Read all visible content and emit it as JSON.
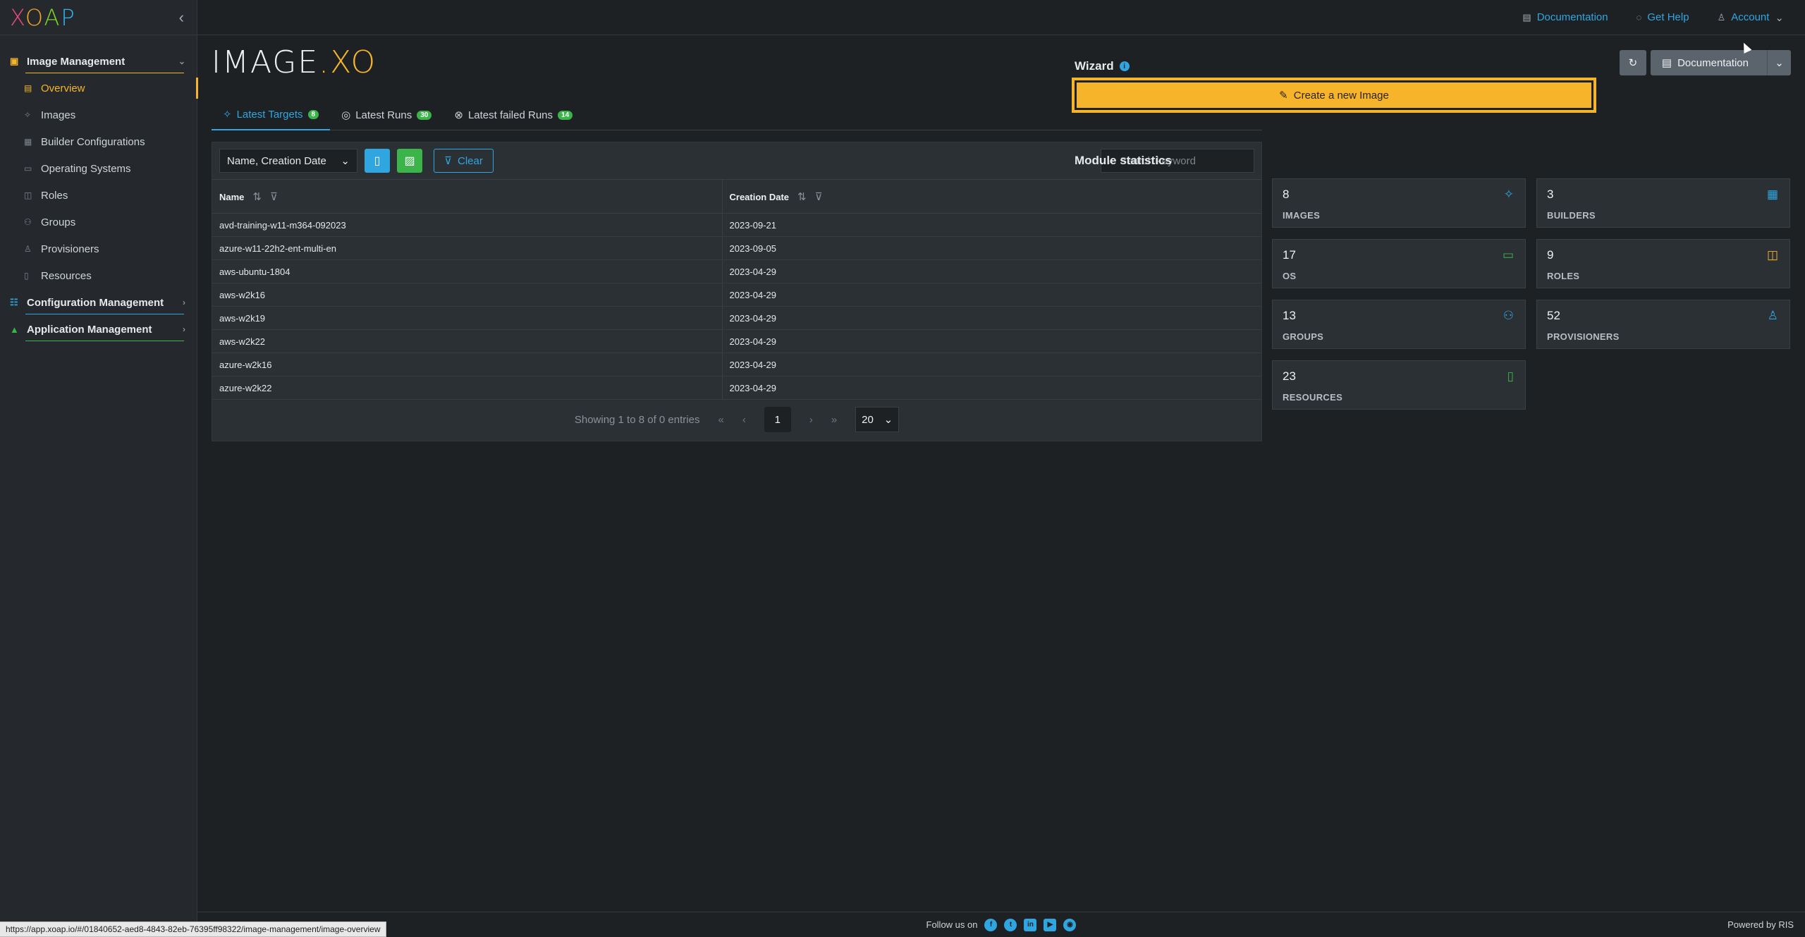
{
  "sidebar": {
    "logo": [
      "X",
      "O",
      "A",
      "P"
    ],
    "collapse_icon": "chevron-left-icon",
    "groups": [
      {
        "label": "Image Management",
        "color": "#f5b42a"
      },
      {
        "label": "Configuration Management",
        "color": "#2fa6e0"
      },
      {
        "label": "Application Management",
        "color": "#3bb44a"
      }
    ],
    "items": [
      {
        "label": "Overview"
      },
      {
        "label": "Images"
      },
      {
        "label": "Builder Configurations"
      },
      {
        "label": "Operating Systems"
      },
      {
        "label": "Roles"
      },
      {
        "label": "Groups"
      },
      {
        "label": "Provisioners"
      },
      {
        "label": "Resources"
      }
    ]
  },
  "topbar": {
    "documentation": "Documentation",
    "get_help": "Get Help",
    "account": "Account"
  },
  "brand": {
    "part1": "IMAGE",
    "dot": ".",
    "part2": "XO"
  },
  "actions": {
    "documentation": "Documentation"
  },
  "tabs": [
    {
      "label": "Latest Targets",
      "count": "8"
    },
    {
      "label": "Latest Runs",
      "count": "30"
    },
    {
      "label": "Latest failed Runs",
      "count": "14"
    }
  ],
  "toolbar": {
    "select_value": "Name, Creation Date",
    "clear_label": "Clear",
    "search_placeholder": "Search keyword"
  },
  "table": {
    "headers": [
      "Name",
      "Creation Date"
    ],
    "rows": [
      [
        "avd-training-w11-m364-092023",
        "2023-09-21"
      ],
      [
        "azure-w11-22h2-ent-multi-en",
        "2023-09-05"
      ],
      [
        "aws-ubuntu-1804",
        "2023-04-29"
      ],
      [
        "aws-w2k16",
        "2023-04-29"
      ],
      [
        "aws-w2k19",
        "2023-04-29"
      ],
      [
        "aws-w2k22",
        "2023-04-29"
      ],
      [
        "azure-w2k16",
        "2023-04-29"
      ],
      [
        "azure-w2k22",
        "2023-04-29"
      ]
    ]
  },
  "pagination": {
    "summary": "Showing 1 to 8 of 0 entries",
    "current_page": "1",
    "per_page": "20"
  },
  "wizard": {
    "title": "Wizard",
    "create_label": "Create a new Image"
  },
  "stats": {
    "title": "Module statistics",
    "cards": [
      {
        "value": "8",
        "label": "IMAGES",
        "icon": "target-icon",
        "color": "#2fa6e0"
      },
      {
        "value": "3",
        "label": "BUILDERS",
        "icon": "grid-icon",
        "color": "#2fa6e0"
      },
      {
        "value": "17",
        "label": "OS",
        "icon": "monitor-icon",
        "color": "#3bb44a"
      },
      {
        "value": "9",
        "label": "ROLES",
        "icon": "map-icon",
        "color": "#f5b42a"
      },
      {
        "value": "13",
        "label": "GROUPS",
        "icon": "users-icon",
        "color": "#2fa6e0"
      },
      {
        "value": "52",
        "label": "PROVISIONERS",
        "icon": "user-icon",
        "color": "#2fa6e0"
      },
      {
        "value": "23",
        "label": "RESOURCES",
        "icon": "file-icon",
        "color": "#3bb44a"
      }
    ]
  },
  "footer": {
    "follow": "Follow us on",
    "powered": "Powered by RIS",
    "status_url": "https://app.xoap.io/#/01840652-aed8-4843-82eb-76395ff98322/image-management/image-overview"
  }
}
